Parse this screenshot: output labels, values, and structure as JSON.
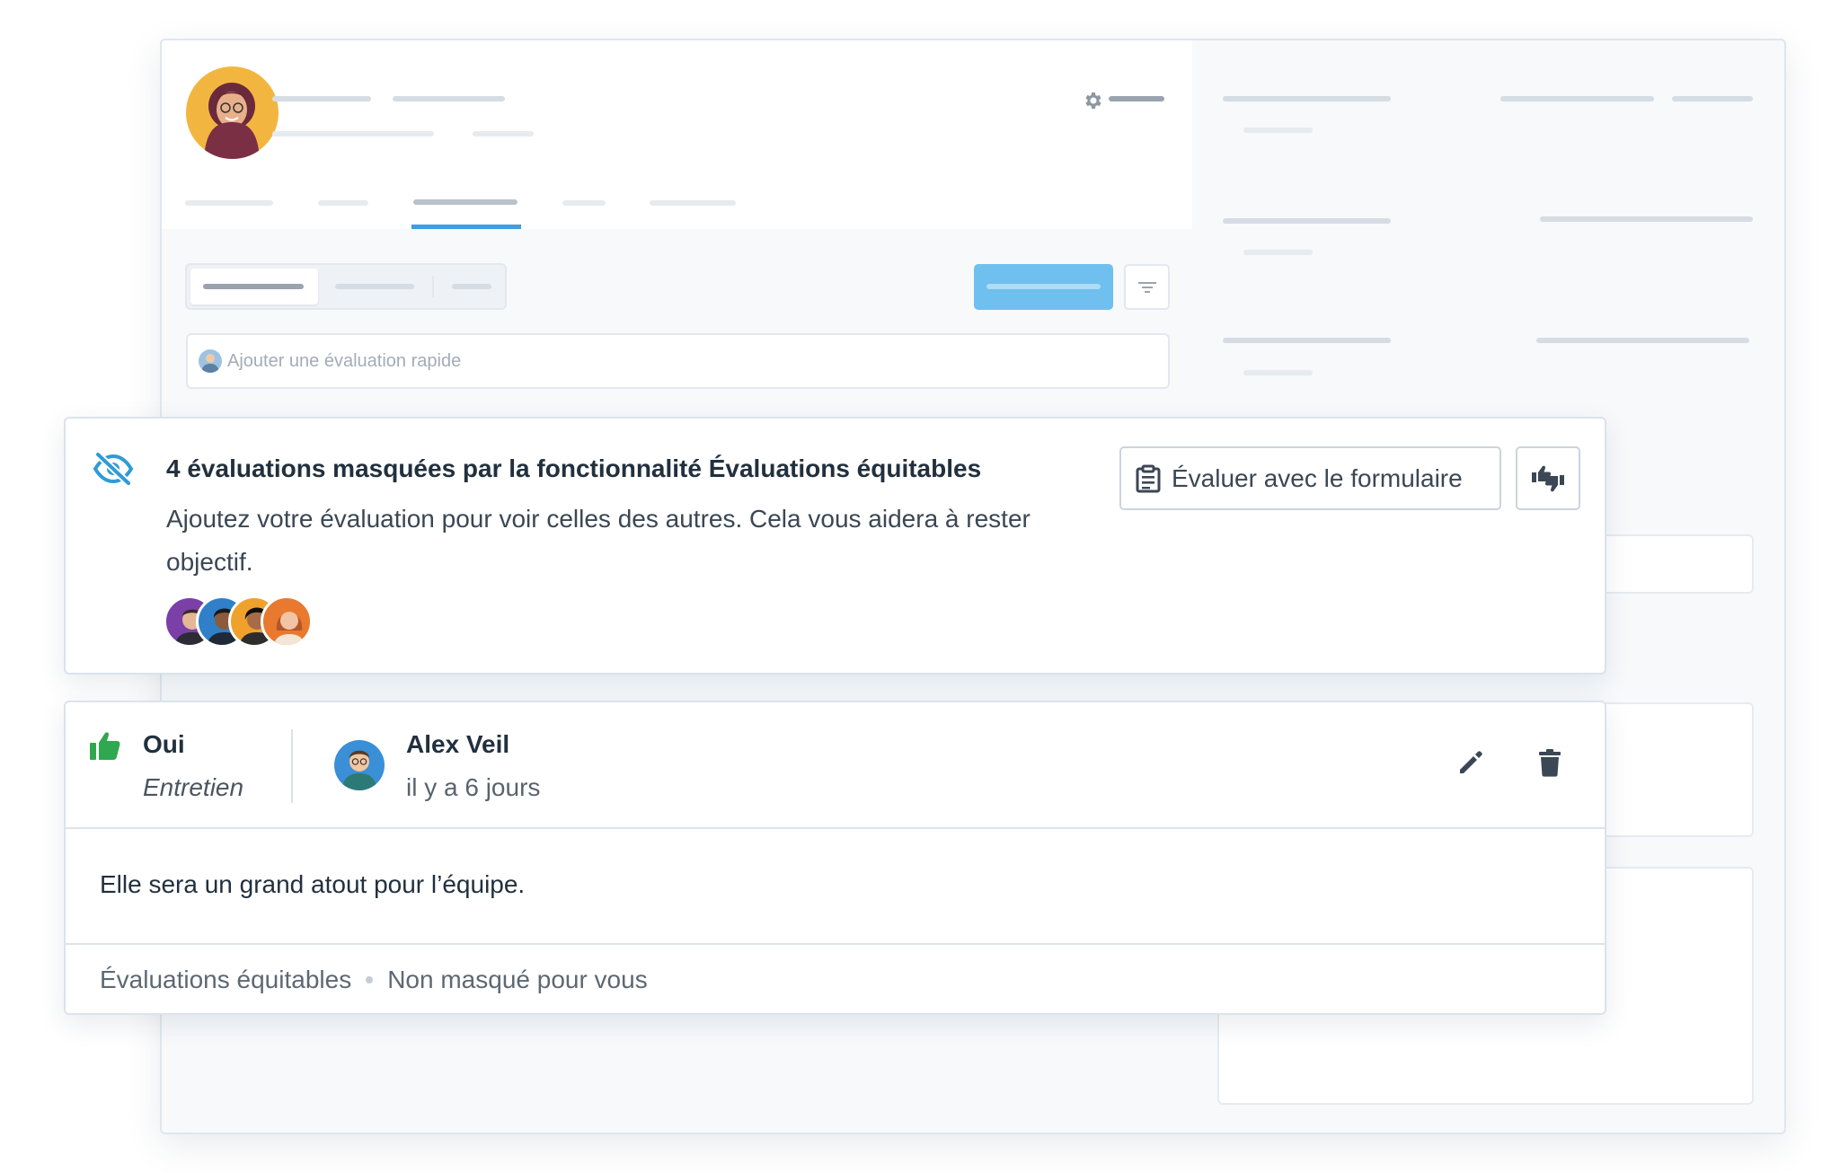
{
  "quick_add": {
    "placeholder": "Ajouter une évaluation rapide"
  },
  "notice": {
    "title": "4 évaluations masquées par la fonctionnalité Évaluations équitables",
    "text": "Ajoutez votre évaluation pour voir celles des autres. Cela vous aidera à rester objectif.",
    "form_button_label": "Évaluer avec le formulaire",
    "hidden_count": 4
  },
  "review": {
    "verdict": "Oui",
    "stage": "Entretien",
    "author": "Alex Veil",
    "time": "il y a 6 jours",
    "comment": "Elle sera un grand atout pour l’équipe.",
    "footer_feature": "Évaluations équitables",
    "footer_status": "Non masqué pour vous"
  },
  "colors": {
    "accent": "#3d9ee0",
    "primary_button": "#6fc0ee",
    "positive": "#2fa84f",
    "eye_icon": "#2f9bd6"
  },
  "icons": {
    "hidden": "eye-slash-icon",
    "form": "clipboard-icon",
    "thumbs": "thumbs-up-down-icon",
    "verdict": "thumbs-up-icon",
    "edit": "pencil-icon",
    "delete": "trash-icon",
    "settings": "gear-icon",
    "filter": "filter-icon"
  }
}
